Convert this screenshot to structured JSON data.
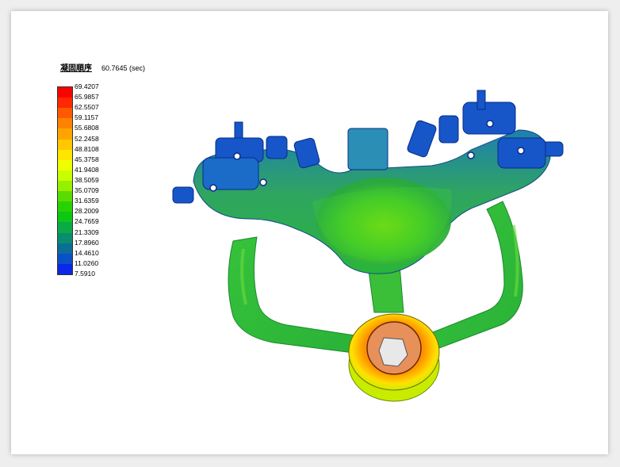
{
  "chart_data": {
    "type": "heatmap",
    "title": "凝固順序",
    "time_readout": "60.7645 (sec)",
    "legend": {
      "placement": "left",
      "ticks": [
        "69.4207",
        "65.9857",
        "62.5507",
        "59.1157",
        "55.6808",
        "52.2458",
        "48.8108",
        "45.3758",
        "41.9408",
        "38.5059",
        "35.0709",
        "31.6359",
        "28.2009",
        "24.7659",
        "21.3309",
        "17.8960",
        "14.4610",
        "11.0260",
        "7.5910"
      ],
      "colors": [
        "#ff0000",
        "#ff2800",
        "#ff5a00",
        "#ff8200",
        "#ffa500",
        "#ffc800",
        "#ffe600",
        "#f0ff00",
        "#c8ff00",
        "#96f000",
        "#5adc00",
        "#28d200",
        "#0ac814",
        "#0aaa46",
        "#0a8c6e",
        "#0a6e96",
        "#0a50c8",
        "#0a28e6",
        "#0000ff"
      ],
      "max": 69.4207,
      "min": 7.591
    }
  }
}
